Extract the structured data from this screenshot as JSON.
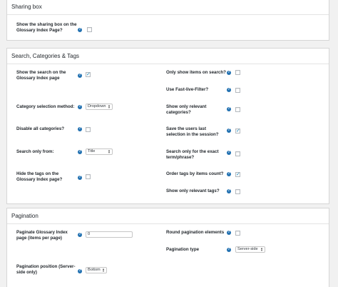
{
  "sharing": {
    "title": "Sharing box",
    "show_sharing_label": "Show the sharing box on the Glossary Index Page?",
    "show_sharing_checked": false
  },
  "search": {
    "title": "Search, Categories & Tags",
    "show_search_label": "Show the search on the Glossary Index page",
    "show_search_checked": true,
    "only_show_items_label": "Only show items on search?",
    "only_show_items_checked": false,
    "fast_live_filter_label": "Use Fast-live-Filter?",
    "fast_live_filter_checked": false,
    "category_method_label": "Category selection method:",
    "category_method_value": "Dropdown",
    "show_relevant_categories_label": "Show only relevant categories?",
    "show_relevant_categories_checked": false,
    "disable_all_categories_label": "Disable all categories?",
    "disable_all_categories_checked": false,
    "save_last_selection_label": "Save the users last selection in the session?",
    "save_last_selection_checked": true,
    "search_only_from_label": "Search only from:",
    "search_only_from_value": "Title",
    "search_exact_label": "Search only for the exact term/phrase?",
    "search_exact_checked": false,
    "hide_tags_label": "Hide the tags on the Glossary Index page?",
    "hide_tags_checked": false,
    "order_tags_label": "Order tags by items count?",
    "order_tags_checked": true,
    "relevant_tags_label": "Show only relevant tags?",
    "relevant_tags_checked": false
  },
  "pagination": {
    "title": "Pagination",
    "per_page_label": "Paginate Glossary Index page (items per page)",
    "per_page_value": "0",
    "round_elements_label": "Round pagination elements",
    "round_elements_checked": false,
    "type_label": "Pagination type",
    "type_value": "Server-side",
    "position_label": "Pagination position (Server-side only)",
    "position_value": "Bottom"
  },
  "icons": {
    "help": "help-icon",
    "dropdown": "updown-arrows-icon",
    "check": "checkmark-icon"
  },
  "colors": {
    "help_icon": "#2271b1",
    "checkmark": "#1e8cbe",
    "background": "#f1f1f1"
  }
}
